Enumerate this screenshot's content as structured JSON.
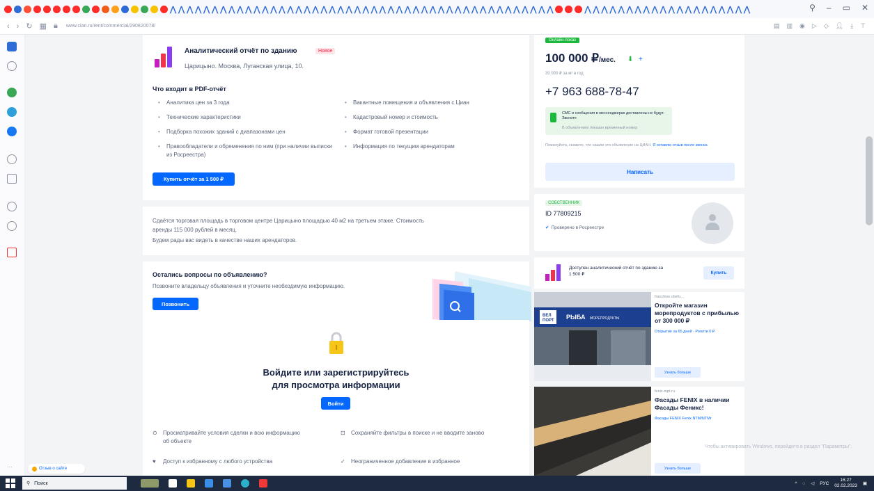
{
  "browser": {
    "url": "www.cian.ru/rent/commercial/290820078/",
    "tab_icon_colors": [
      "#ff2b2b",
      "#2e6bd6",
      "#ff4f36",
      "#ff2b2b",
      "#ff2b2b",
      "#ff2b2b",
      "#ff2b2b",
      "#ff2b2b",
      "#3aa757",
      "#ff2b2b",
      "#f25c1a",
      "#ff9f1a",
      "#2e6bd6",
      "#f7c200",
      "#3aa757",
      "#f7c200",
      "#ff2b2b"
    ],
    "tab_chevron_count": 66,
    "right_tab_icon_colors": [
      "#ff2b2b",
      "#ff2b2b",
      "#ff2b2b"
    ]
  },
  "report": {
    "title": "Аналитический отчёт по зданию",
    "badge": "Новое",
    "address": "Царицыно. Москва, Луганская улица, 10.",
    "pdf_heading": "Что входит в PDF-отчёт",
    "features_left": [
      "Аналитика цен за 3 года",
      "Технические характеристики",
      "Подборка похожих зданий с диапазонами цен",
      "Правообладатели и обременения по ним (при наличии выписки из Росреестра)"
    ],
    "features_right": [
      "Вакантные помещения и объявления с Циан",
      "Кадастровый номер и стоимость",
      "Формат готовой презентации",
      "Информация по текущим арендаторам"
    ],
    "buy_label": "Купить отчёт за 1 500 ₽"
  },
  "description": {
    "lines": [
      "Сдаётся торговая площадь в торговом центре Царицыно площадью 40 м2 на третьем этаже. Стоимость",
      "аренды 115 000 рублей в месяц.",
      "Будем рады вас видеть в качестве наших арендаторов."
    ]
  },
  "questions": {
    "title": "Остались вопросы по объявлению?",
    "subtitle": "Позвоните владельцу объявления и уточните необходимую информацию.",
    "call_label": "Позвонить"
  },
  "login": {
    "title_line1": "Войдите или зарегистрируйтесь",
    "title_line2": "для просмотра информации",
    "button": "Войти",
    "benefits": [
      {
        "icon": "eye-icon",
        "glyph": "⊙",
        "text": "Просматривайте условия сделки и всю информацию об объекте"
      },
      {
        "icon": "filter-save-icon",
        "glyph": "⊡",
        "text": "Сохраняйте фильтры в поиске и не вводите заново"
      },
      {
        "icon": "heart-icon",
        "glyph": "♥",
        "text": "Доступ к избранному с любого устройства"
      },
      {
        "icon": "check-icon",
        "glyph": "✓",
        "text": "Неограниченное добавление в избранное"
      }
    ]
  },
  "price_card": {
    "badge": "Онлайн-показ",
    "price": "100 000 ₽",
    "price_unit": "/мес.",
    "price_sub": "30 000 ₽ за м² в год",
    "phone": "+7 963 688-78-47",
    "sms_text": "СМС и сообщения в мессенджерах доставлены не будут. Звоните",
    "sms_sub": "В объявлениях показан временный номер",
    "note": "Пожалуйста, скажите, что нашли это объявление на ЦИАН.",
    "note_link": "Я оставлю отзыв после звонка",
    "write_label": "Написать"
  },
  "owner": {
    "tag": "СОБСТВЕННИК",
    "id": "ID 77809215",
    "verified": "Проверено в Росреестре"
  },
  "mini_report": {
    "text": "Доступен аналитический отчёт по зданию за 1 500 ₽",
    "button": "Купить"
  },
  "ads": [
    {
      "source": "franchise.cbefu...",
      "title": "Откройте магазин морепродуктов с прибылью от 300 000 ₽",
      "link": "Открытие за 65 дней · Роялти 0 ₽",
      "button": "Узнать больше",
      "sign_text": "РЫБА МОРЕПРОДУКТЫ"
    },
    {
      "source": "fenix-mpt.ru",
      "title": "Фасады FENIX в наличии Фасады Феникс!",
      "link": "Фасады FENIX Fenix NTM/NTMr",
      "button": "Узнать больше"
    }
  ],
  "activate_text": "Чтобы активировать Windows, перейдите в раздел \"Параметры\".",
  "chat_label": "Отзыв о сайте",
  "taskbar": {
    "search_placeholder": "Поиск",
    "lang": "РУС",
    "time": "16:27",
    "date": "02.02.2023"
  }
}
